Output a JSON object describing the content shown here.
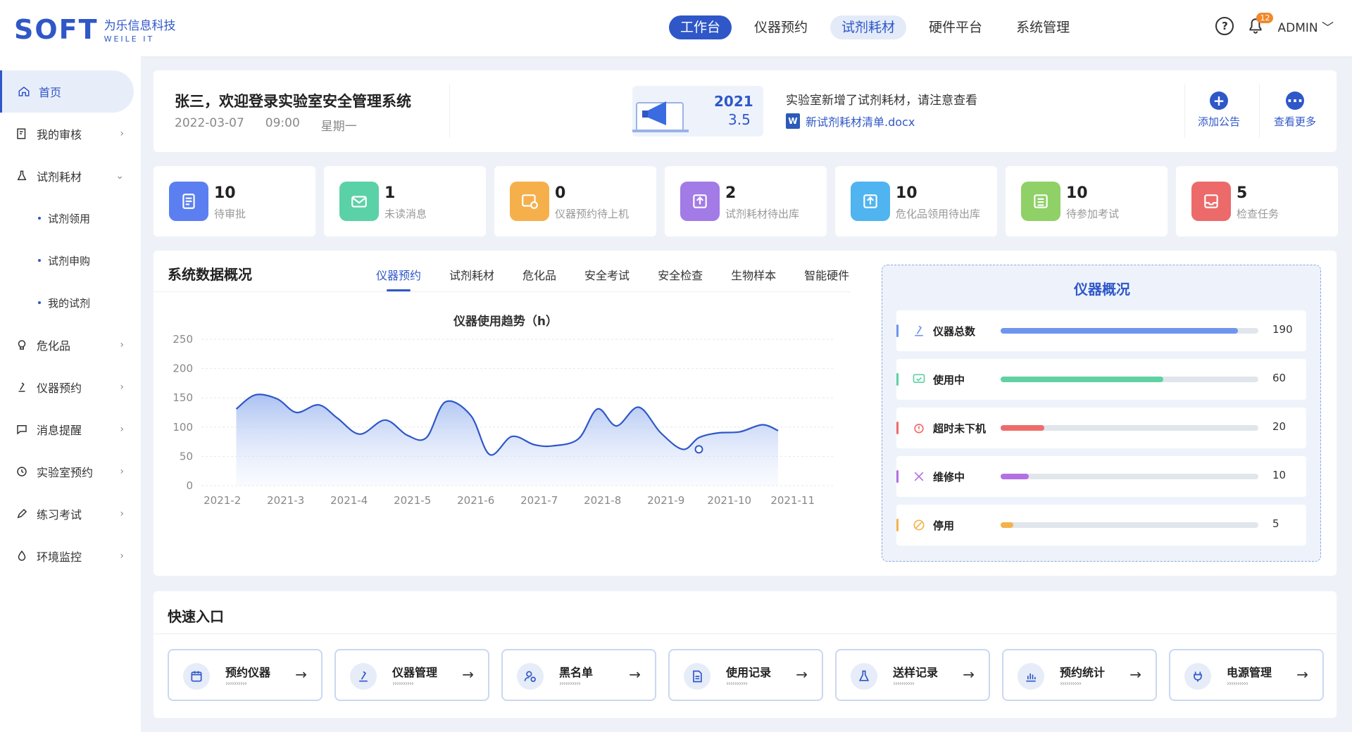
{
  "brand": {
    "logo_text": "SOFT",
    "name_cn": "为乐信息科技",
    "name_en": "WEILE IT"
  },
  "topnav": [
    "工作台",
    "仪器预约",
    "试剂耗材",
    "硬件平台",
    "系统管理"
  ],
  "header": {
    "notification_count": "12",
    "user": "ADMIN"
  },
  "sidebar": {
    "items": [
      "首页",
      "我的审核",
      "试剂耗材",
      "危化品",
      "仪器预约",
      "消息提醒",
      "实验室预约",
      "练习考试",
      "环境监控"
    ],
    "subitems": [
      "试剂领用",
      "试剂申购",
      "我的试剂"
    ]
  },
  "welcome": {
    "greeting": "张三，欢迎登录实验室安全管理系统",
    "date": "2022-03-07",
    "time": "09:00",
    "weekday": "星期一"
  },
  "announcement": {
    "year": "2021",
    "day": "3.5",
    "text": "实验室新增了试剂耗材，请注意查看",
    "file": "新试剂耗材清单.docx",
    "add_label": "添加公告",
    "more_label": "查看更多"
  },
  "stats": [
    {
      "value": "10",
      "label": "待审批",
      "color": "#5b7ff0"
    },
    {
      "value": "1",
      "label": "未读消息",
      "color": "#5bd1a8"
    },
    {
      "value": "0",
      "label": "仪器预约待上机",
      "color": "#f5b04c"
    },
    {
      "value": "2",
      "label": "试剂耗材待出库",
      "color": "#a27be6"
    },
    {
      "value": "10",
      "label": "危化品领用待出库",
      "color": "#4fb4ef"
    },
    {
      "value": "10",
      "label": "待参加考试",
      "color": "#8fd067"
    },
    {
      "value": "5",
      "label": "检查任务",
      "color": "#ec6a6a"
    }
  ],
  "overview": {
    "title": "系统数据概况",
    "tabs": [
      "仪器预约",
      "试剂耗材",
      "危化品",
      "安全考试",
      "安全检查",
      "生物样本",
      "智能硬件"
    ],
    "active_tab": "仪器预约"
  },
  "chart_data": {
    "type": "area",
    "title": "仪器使用趋势（h）",
    "categories": [
      "2021-2",
      "2021-3",
      "2021-4",
      "2021-5",
      "2021-6",
      "2021-7",
      "2021-8",
      "2021-9",
      "2021-10",
      "2021-11"
    ],
    "x": [
      1.55,
      1.85,
      2.2,
      2.5,
      2.85,
      3.15,
      3.5,
      3.9,
      4.25,
      4.55,
      4.85,
      5.25,
      5.55,
      5.9,
      6.25,
      6.55,
      6.95,
      7.25,
      7.55,
      7.9,
      8.25,
      8.6,
      8.85,
      9.15,
      9.5,
      9.85,
      10.1
    ],
    "values": [
      131,
      155,
      148,
      125,
      138,
      115,
      88,
      112,
      86,
      82,
      143,
      120,
      53,
      84,
      70,
      68,
      80,
      131,
      102,
      134,
      90,
      62,
      82,
      90,
      92,
      104,
      94
    ],
    "highlight_x": 8.85,
    "highlight_y": 62,
    "ylim": [
      0,
      250
    ],
    "yticks": [
      "0",
      "50",
      "100",
      "150",
      "200",
      "250"
    ],
    "line_color": "#2f57c8",
    "grid": true
  },
  "instrument_panel": {
    "title": "仪器概况",
    "rows": [
      {
        "label": "仪器总数",
        "value": "190",
        "fraction": 0.92,
        "color": "#6e95ee"
      },
      {
        "label": "使用中",
        "value": "60",
        "fraction": 0.63,
        "color": "#5fd1a3"
      },
      {
        "label": "超时未下机",
        "value": "20",
        "fraction": 0.17,
        "color": "#ef6b6b"
      },
      {
        "label": "维修中",
        "value": "10",
        "fraction": 0.11,
        "color": "#b470e0"
      },
      {
        "label": "停用",
        "value": "5",
        "fraction": 0.05,
        "color": "#f3b34a"
      }
    ]
  },
  "quick": {
    "title": "快速入口",
    "items": [
      "预约仪器",
      "仪器管理",
      "黑名单",
      "使用记录",
      "送样记录",
      "预约统计",
      "电源管理"
    ],
    "arrows": "››››››››››"
  }
}
